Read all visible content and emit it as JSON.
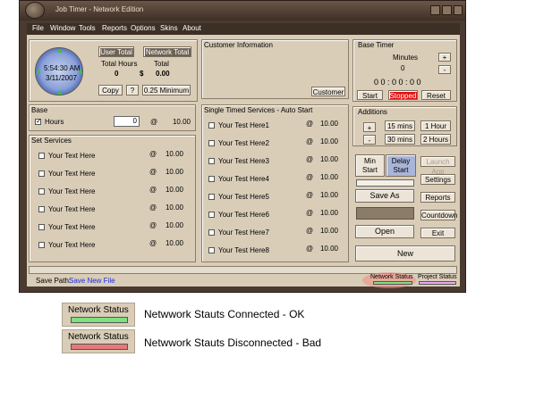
{
  "window": {
    "title": "Job Timer - Network Edition"
  },
  "menu": [
    "File",
    "Window",
    "Tools",
    "Reports",
    "Options",
    "Skins",
    "About"
  ],
  "clock": {
    "time": "5:54:30 AM",
    "date": "3/11/2007"
  },
  "totals": {
    "user_total": "User Total",
    "network_total": "Network Total",
    "total_hours_label": "Total Hours",
    "total_label": "Total",
    "hours_value": "0",
    "currency": "$",
    "amount": "0.00",
    "copy": "Copy",
    "help": "?",
    "minimum": "0.25 Minimum"
  },
  "customer": {
    "title": "Customer Information",
    "button": "Customer"
  },
  "base_timer": {
    "title": "Base Timer",
    "minutes_label": "Minutes",
    "minutes_value": "0",
    "plus": "+",
    "minus": "-",
    "display": "0 0 : 0 0 : 0 0",
    "start": "Start",
    "stopped": "Stopped",
    "reset": "Reset"
  },
  "base": {
    "title": "Base",
    "label": "Hours",
    "input": "0",
    "at": "@",
    "rate": "10.00"
  },
  "set_services": {
    "title": "Set Services",
    "items": [
      {
        "label": "Your Text Here",
        "at": "@",
        "rate": "10.00"
      },
      {
        "label": "Your Text Here",
        "at": "@",
        "rate": "10.00"
      },
      {
        "label": "Your Text Here",
        "at": "@",
        "rate": "10.00"
      },
      {
        "label": "Your Text Here",
        "at": "@",
        "rate": "10.00"
      },
      {
        "label": "Your Text Here",
        "at": "@",
        "rate": "10.00"
      },
      {
        "label": "Your Text Here",
        "at": "@",
        "rate": "10.00"
      }
    ]
  },
  "single_services": {
    "title": "Single Timed Services - Auto Start",
    "items": [
      {
        "label": "Your Test Here1",
        "at": "@",
        "rate": "10.00"
      },
      {
        "label": "Your Test Here2",
        "at": "@",
        "rate": "10.00"
      },
      {
        "label": "Your Test Here3",
        "at": "@",
        "rate": "10.00"
      },
      {
        "label": "Your Test Here4",
        "at": "@",
        "rate": "10.00"
      },
      {
        "label": "Your Test Here5",
        "at": "@",
        "rate": "10.00"
      },
      {
        "label": "Your Test Here6",
        "at": "@",
        "rate": "10.00"
      },
      {
        "label": "Your Test Here7",
        "at": "@",
        "rate": "10.00"
      },
      {
        "label": "Your Test Here8",
        "at": "@",
        "rate": "10.00"
      }
    ]
  },
  "additions": {
    "title": "Additions",
    "plus": "+",
    "minus": "-",
    "m15": "15 mins",
    "h1": "1 Hour",
    "m30": "30 mins",
    "h2": "2 Hours"
  },
  "actions": {
    "min_start": "Min Start",
    "delay_start": "Delay Start",
    "launch_app": "Launch App",
    "settings": "Settings",
    "save_as": "Save As",
    "reports": "Reports",
    "countdown": "Countdown",
    "open": "Open",
    "exit": "Exit",
    "new": "New"
  },
  "statusbar": {
    "save_path_label": "Save Path:",
    "save_path_value": "Save New File",
    "network_status": "Network Status",
    "project_status": "Project Status"
  },
  "legend": [
    {
      "label": "Network Status",
      "text": "Netwwork Stauts Connected - OK",
      "color": "#7fe07f"
    },
    {
      "label": "Network Status",
      "text": "Netwwork Stauts Disconnected - Bad",
      "color": "#e87878"
    }
  ],
  "colors": {
    "stopped": "#e01010",
    "ok": "#7fe07f",
    "bad": "#e87878",
    "link": "#1a2ee0"
  }
}
